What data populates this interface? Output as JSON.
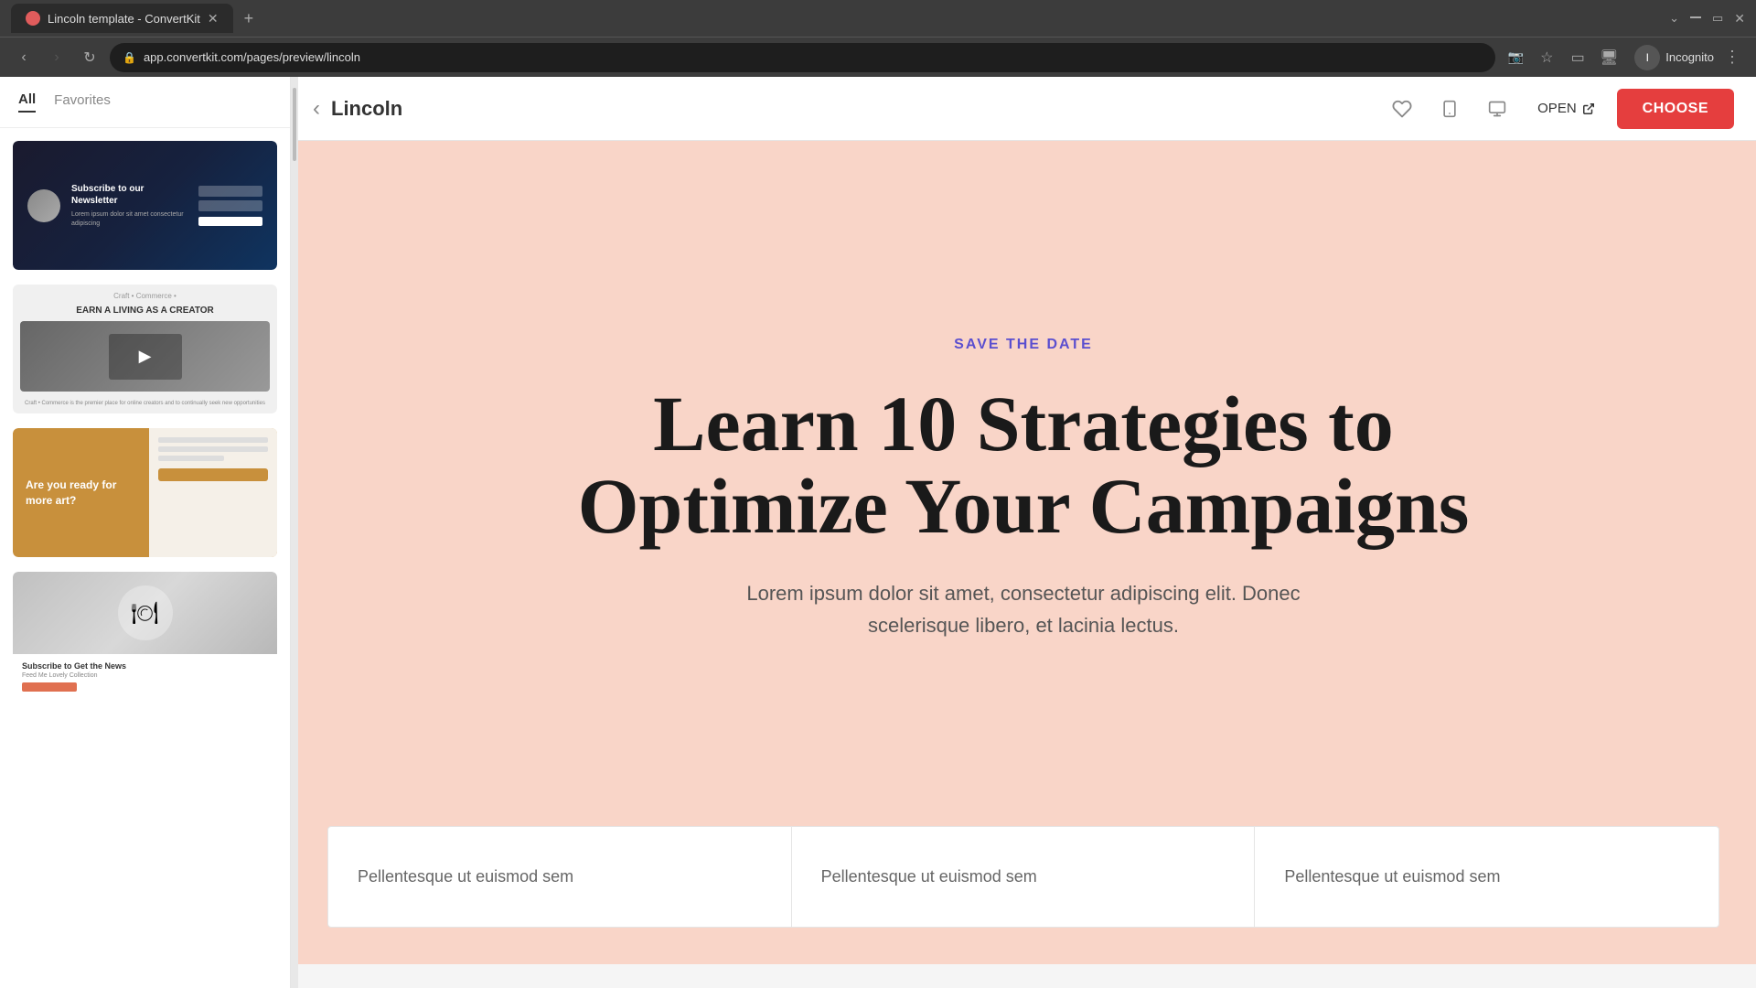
{
  "browser": {
    "tab_title": "Lincoln template - ConvertKit",
    "tab_favicon_color": "#e05c5c",
    "url": "app.convertkit.com/pages/preview/lincoln",
    "profile_name": "Incognito"
  },
  "sidebar": {
    "tabs": [
      {
        "label": "All",
        "active": true
      },
      {
        "label": "Favorites",
        "active": false
      }
    ],
    "templates": [
      {
        "id": 1,
        "alt": "Newsletter dark template"
      },
      {
        "id": 2,
        "alt": "Earn a living as a creator template"
      },
      {
        "id": 3,
        "alt": "Are you ready for more art template"
      },
      {
        "id": 4,
        "alt": "Subscribe food template"
      }
    ]
  },
  "header": {
    "title": "Lincoln",
    "back_label": "‹",
    "open_label": "OPEN",
    "choose_label": "CHOOSE"
  },
  "preview": {
    "save_date_label": "SAVE THE DATE",
    "main_heading_line1": "Learn 10 Strategies to",
    "main_heading_line2": "Optimize Your Campaigns",
    "description": "Lorem ipsum dolor sit amet, consectetur adipiscing elit. Donec scelerisque libero, et lacinia lectus.",
    "grid_cells": [
      {
        "text": "Pellentesque ut euismod sem"
      },
      {
        "text": "Pellentesque ut euismod sem"
      },
      {
        "text": "Pellentesque ut euismod sem"
      }
    ]
  },
  "card1": {
    "title": "Subscribe to our Newsletter",
    "subtitle": "Lorem ipsum dolor sit amet consectetur adipiscing"
  },
  "card2": {
    "brand": "Craft • Commerce •",
    "title": "EARN A LIVING AS A CREATOR",
    "description": "Craft • Commerce is the premier place for online creators and to continually seek new opportunities"
  },
  "card3": {
    "question": "Are you ready for more art?"
  },
  "card4": {
    "title": "Subscribe to Get the News",
    "subtitle": "Feed Me Lovely Collection"
  }
}
